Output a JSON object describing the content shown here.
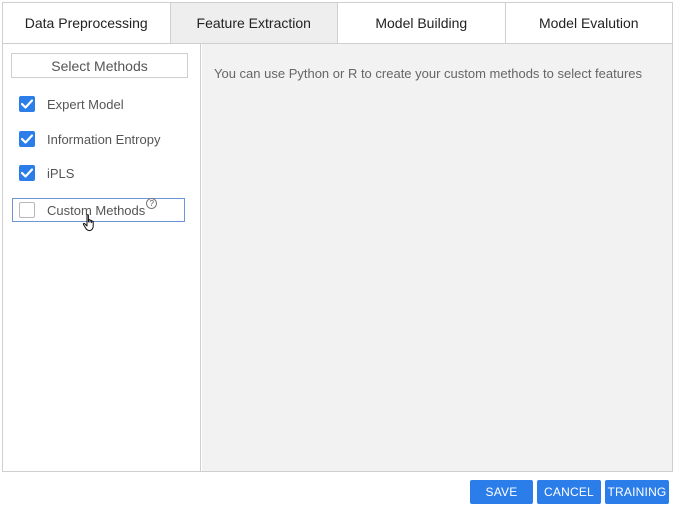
{
  "tabs": [
    {
      "label": "Data Preprocessing",
      "active": false
    },
    {
      "label": "Feature Extraction",
      "active": true
    },
    {
      "label": "Model Building",
      "active": false
    },
    {
      "label": "Model Evalution",
      "active": false
    }
  ],
  "sidebar": {
    "title": "Select Methods",
    "methods": [
      {
        "label": "Expert Model",
        "checked": true
      },
      {
        "label": "Information Entropy",
        "checked": true
      },
      {
        "label": "iPLS",
        "checked": true
      },
      {
        "label": "Custom Methods",
        "checked": false,
        "help": "?"
      }
    ]
  },
  "content": {
    "text": "You can use Python or R to create your custom methods to select features"
  },
  "actions": {
    "save": "SAVE",
    "cancel": "CANCEL",
    "training": "TRAINING"
  },
  "colors": {
    "accent": "#2b7de9",
    "content_bg": "#f2f2f2",
    "active_tab_bg": "#eeeeee"
  }
}
